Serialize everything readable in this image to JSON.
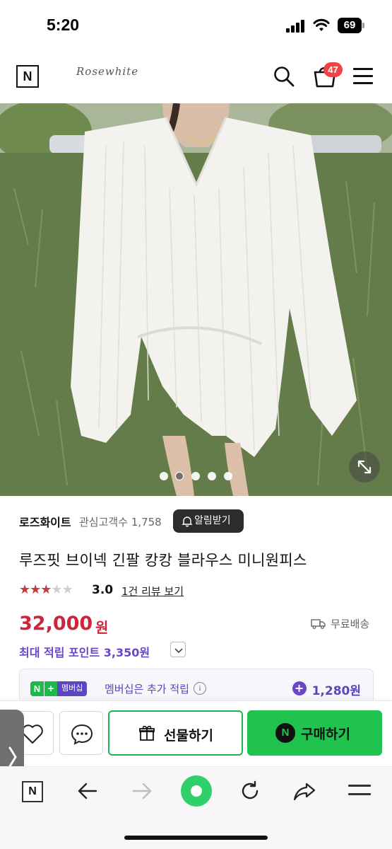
{
  "status_bar": {
    "time": "5:20",
    "battery": "69"
  },
  "header": {
    "logo_letter": "N",
    "brand": "Rosewhite",
    "cart_count": "47"
  },
  "gallery": {
    "image_description": "white blouse mini dress photo",
    "total_images": 5,
    "active_index": 1
  },
  "seller": {
    "name": "로즈화이트",
    "interest_label": "관심고객수 1,758",
    "alarm_button": "알림받기"
  },
  "product": {
    "title": "루즈핏 브이넥 긴팔 캉캉 블라우스 미니원피스",
    "rating_stars": 3,
    "rating": "3.0",
    "review_link": "1건 리뷰 보기",
    "price": "32,000",
    "price_unit": "원",
    "shipping": "무료배송",
    "max_points": "최대 적립 포인트 3,350원"
  },
  "membership": {
    "badge_n": "N",
    "badge_plus": "+",
    "badge_text": "멤버십",
    "text": "멤버십은 추가 적립",
    "info": "i",
    "points": "1,280원"
  },
  "purchase_bar": {
    "gift_label": "선물하기",
    "buy_label": "구매하기",
    "buy_icon_letter": "N"
  },
  "browser": {
    "logo_letter": "N"
  },
  "colors": {
    "price": "#d0243a",
    "points": "#6a47c9",
    "buy_green": "#1fc34e",
    "star": "#c23a3a"
  }
}
